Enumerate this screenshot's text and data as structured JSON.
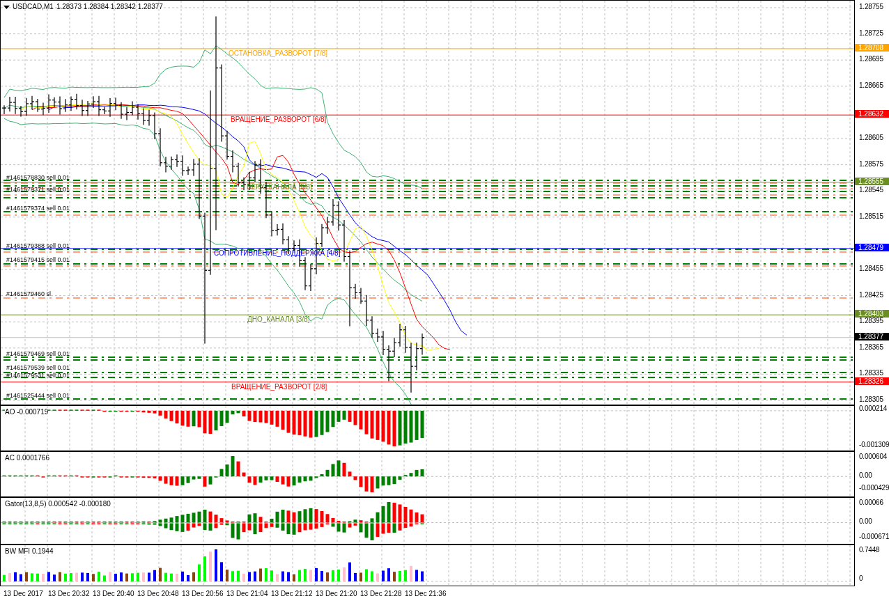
{
  "chart_header": {
    "symbol": "USDCAD,M1",
    "quote": "1.28373 1.28384 1.28342 1.28377"
  },
  "level_lines": [
    {
      "label": "ОСТАНОВКА_РАЗВОРОТ [7/8]",
      "price_tag": "1.28708",
      "color": "#ffa500"
    },
    {
      "label": "ВРАЩЕНИЕ_РАЗВОРОТ [6/8]",
      "price_tag": "1.28632",
      "color": "#ff0000"
    },
    {
      "label": "ВЕРХ_КАНАЛА [5/8]",
      "price_tag": "1.28555",
      "color": "#6b8e23"
    },
    {
      "label": "СОПРОТИВЛЕНИЕ_ПОДДЕРЖКА [4/8]",
      "price_tag": "1.28479",
      "color": "#0000ff"
    },
    {
      "label": "ДНО_КАНАЛА [3/8]",
      "price_tag": "1.28403",
      "color": "#6b8e23"
    },
    {
      "label": "ВРАЩЕНИЕ_РАЗВОРОТ [2/8]",
      "price_tag": "1.28326",
      "color": "#ff0000"
    }
  ],
  "current_price": {
    "price_tag": "1.28377"
  },
  "order_labels": [
    {
      "text": "#1461578830 sell 0.01"
    },
    {
      "text": "#1461579371 sell 0.01"
    },
    {
      "text": "#1461579374 sell 0.01"
    },
    {
      "text": "#1461579388 sell 0.01"
    },
    {
      "text": "#1461579415 sell 0.01"
    },
    {
      "text": "#1461579460 sl"
    },
    {
      "text": "#1461579469 sell 0.01"
    },
    {
      "text": "#1461579539 sell 0.01"
    },
    {
      "text": "#1461579531 sell 0.01"
    },
    {
      "text": "#1461525444 sell 0.01"
    }
  ],
  "price_axis": {
    "ticks": [
      "1.28755",
      "1.28725",
      "1.28695",
      "1.28665",
      "1.28605",
      "1.28575",
      "1.28545",
      "1.28515",
      "1.28455",
      "1.28425",
      "1.28395",
      "1.28365",
      "1.28335",
      "1.28305"
    ]
  },
  "indicator_panes": [
    {
      "kind": "ao",
      "label": "AO -0.000719",
      "scale": [
        "0.000214",
        "-0.001309"
      ]
    },
    {
      "kind": "ac",
      "label": "AC 0.0001766",
      "scale": [
        "0.000604",
        "0.00",
        "-0.000429"
      ]
    },
    {
      "kind": "gator",
      "label": "Gator(13,8,5) 0.000542 -0.000180",
      "scale": [
        "0.00066",
        "0.00",
        "-0.000671"
      ]
    },
    {
      "kind": "mfi",
      "label": "BW MFI 0.1944",
      "scale": [
        "0.7448",
        "0"
      ]
    }
  ],
  "time_axis": {
    "labels": [
      "13 Dec 2017",
      "13 Dec 20:32",
      "13 Dec 20:40",
      "13 Dec 20:48",
      "13 Dec 20:56",
      "13 Dec 21:04",
      "13 Dec 21:12",
      "13 Dec 21:20",
      "13 Dec 21:28",
      "13 Dec 21:36"
    ]
  }
}
